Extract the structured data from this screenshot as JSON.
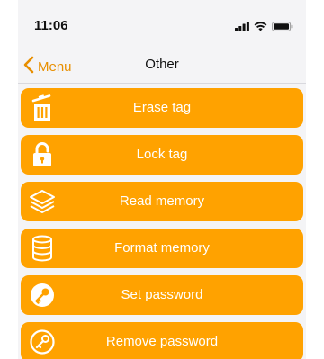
{
  "status_bar": {
    "time": "11:06",
    "icons": [
      "signal-icon",
      "wifi-icon",
      "battery-icon"
    ]
  },
  "nav": {
    "back_label": "Menu",
    "title": "Other"
  },
  "colors": {
    "accent": "#ffa200",
    "back": "#e88f00",
    "background": "#f4f4f6"
  },
  "actions": [
    {
      "label": "Erase tag",
      "icon": "trash-icon"
    },
    {
      "label": "Lock tag",
      "icon": "lock-icon"
    },
    {
      "label": "Read memory",
      "icon": "layers-icon"
    },
    {
      "label": "Format memory",
      "icon": "database-icon"
    },
    {
      "label": "Set password",
      "icon": "key-icon"
    },
    {
      "label": "Remove password",
      "icon": "key-outline-icon"
    }
  ]
}
